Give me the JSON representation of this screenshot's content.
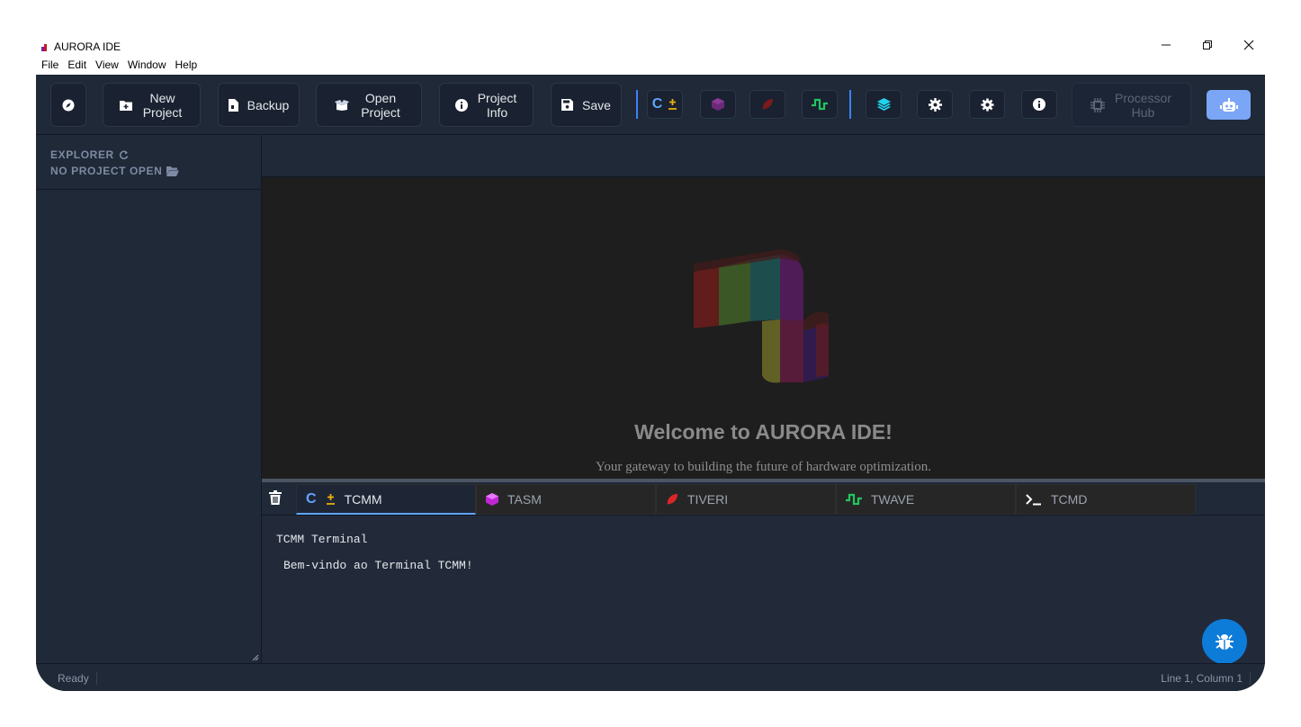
{
  "window": {
    "title": "AURORA IDE",
    "menu": [
      "File",
      "Edit",
      "View",
      "Window",
      "Help"
    ]
  },
  "toolbar": {
    "new_project": "New Project",
    "backup": "Backup",
    "open_project": "Open Project",
    "project_info": "Project Info",
    "save": "Save",
    "processor_hub": "Processor Hub",
    "cmm_glyph": "C"
  },
  "sidebar": {
    "explorer_label": "EXPLORER",
    "no_project_label": "NO PROJECT OPEN"
  },
  "welcome": {
    "title": "Welcome to AURORA IDE!",
    "subtitle": "Your gateway to building the future of hardware optimization."
  },
  "terminal": {
    "tabs": [
      {
        "label": "TCMM",
        "active": true
      },
      {
        "label": "TASM",
        "active": false
      },
      {
        "label": "TIVERI",
        "active": false
      },
      {
        "label": "TWAVE",
        "active": false
      },
      {
        "label": "TCMD",
        "active": false
      }
    ],
    "lines": [
      "TCMM Terminal",
      "Bem-vindo ao Terminal TCMM!"
    ]
  },
  "status": {
    "left": "Ready",
    "right": "Line 1, Column 1"
  },
  "colors": {
    "accent": "#3b82f6",
    "bug_button": "#0d7bd8",
    "robot_button": "#7aa6f5"
  }
}
